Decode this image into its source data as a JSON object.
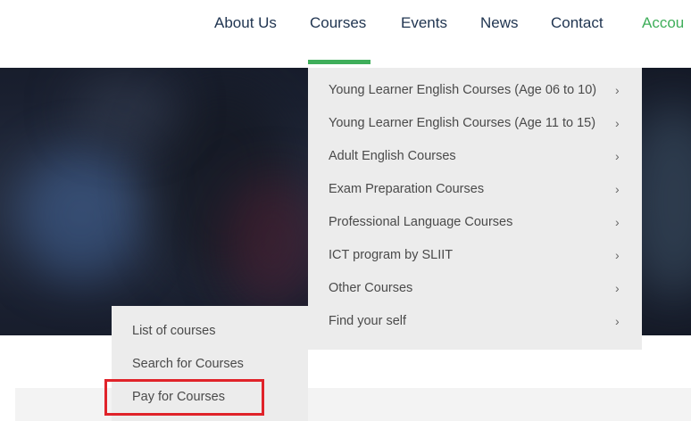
{
  "nav": {
    "items": [
      {
        "label": "About Us"
      },
      {
        "label": "Courses"
      },
      {
        "label": "Events"
      },
      {
        "label": "News"
      },
      {
        "label": "Contact"
      },
      {
        "label": "Accou"
      }
    ],
    "active": "Courses",
    "accent_color": "#3fae5a",
    "text_color": "#1f3450"
  },
  "courses_menu": {
    "items": [
      {
        "label": "Young Learner English Courses (Age 06 to 10)",
        "chevron": "›"
      },
      {
        "label": "Young Learner English Courses (Age 11 to 15)",
        "chevron": "›"
      },
      {
        "label": "Adult English Courses",
        "chevron": "›"
      },
      {
        "label": "Exam Preparation Courses",
        "chevron": "›"
      },
      {
        "label": "Professional Language Courses",
        "chevron": "›"
      },
      {
        "label": "ICT program by SLIIT",
        "chevron": "›"
      },
      {
        "label": "Other Courses",
        "chevron": "›"
      },
      {
        "label": "Find your self",
        "chevron": "›"
      }
    ]
  },
  "sub_menu": {
    "items": [
      {
        "label": "List of courses"
      },
      {
        "label": "Search for Courses"
      },
      {
        "label": "Pay for Courses"
      }
    ],
    "highlighted": "Pay for Courses",
    "highlight_color": "#e0232a"
  }
}
